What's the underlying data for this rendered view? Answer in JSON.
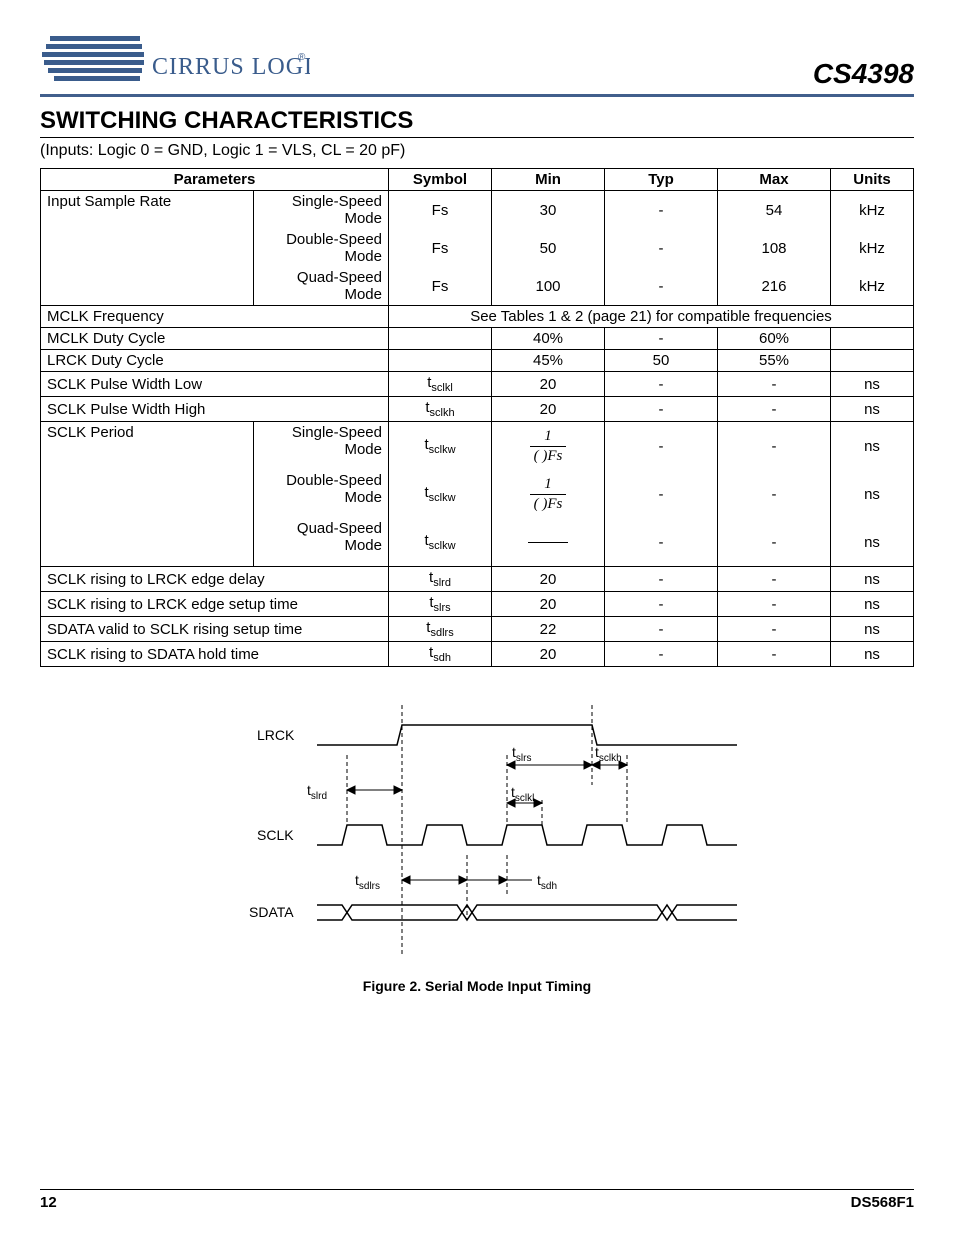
{
  "logo_text": "CIRRUS LOGIC",
  "logo_mark": "®",
  "part_number": "CS4398",
  "section_title": "SWITCHING CHARACTERISTICS",
  "conditions": "(Inputs: Logic 0 = GND, Logic 1 = VLS, CL = 20 pF)",
  "headers": {
    "parameters": "Parameters",
    "symbol": "Symbol",
    "min": "Min",
    "typ": "Typ",
    "max": "Max",
    "units": "Units"
  },
  "rows": {
    "isr": {
      "label": "Input Sample Rate",
      "modes": {
        "single": {
          "label": "Single-Speed Mode",
          "symbol": "Fs",
          "min": "30",
          "typ": "-",
          "max": "54",
          "units": "kHz"
        },
        "double": {
          "label": "Double-Speed Mode",
          "symbol": "Fs",
          "min": "50",
          "typ": "-",
          "max": "108",
          "units": "kHz"
        },
        "quad": {
          "label": "Quad-Speed Mode",
          "symbol": "Fs",
          "min": "100",
          "typ": "-",
          "max": "216",
          "units": "kHz"
        }
      }
    },
    "mclk_freq": {
      "label": "MCLK Frequency",
      "note": "See Tables 1 & 2 (page 21) for compatible frequencies"
    },
    "mclk_duty": {
      "label": "MCLK Duty Cycle",
      "min": "40%",
      "typ": "-",
      "max": "60%"
    },
    "lrck_duty": {
      "label": "LRCK Duty Cycle",
      "min": "45%",
      "typ": "50",
      "max": "55%"
    },
    "sclk_pwl": {
      "label": "SCLK Pulse Width Low",
      "sym_main": "t",
      "sym_sub": "sclkl",
      "min": "20",
      "typ": "-",
      "max": "-",
      "units": "ns"
    },
    "sclk_pwh": {
      "label": "SCLK Pulse Width High",
      "sym_main": "t",
      "sym_sub": "sclkh",
      "min": "20",
      "typ": "-",
      "max": "-",
      "units": "ns"
    },
    "sclk_period": {
      "label": "SCLK Period",
      "modes": {
        "single": {
          "label": "Single-Speed Mode",
          "sym_main": "t",
          "sym_sub": "sclkw",
          "frac_num": "1",
          "frac_den": "(   )Fs",
          "typ": "-",
          "max": "-",
          "units": "ns"
        },
        "double": {
          "label": "Double-Speed Mode",
          "sym_main": "t",
          "sym_sub": "sclkw",
          "frac_num": "1",
          "frac_den": "(   )Fs",
          "typ": "-",
          "max": "-",
          "units": "ns"
        },
        "quad": {
          "label": "Quad-Speed Mode",
          "sym_main": "t",
          "sym_sub": "sclkw",
          "typ": "-",
          "max": "-",
          "units": "ns"
        }
      }
    },
    "slrd": {
      "label": "SCLK rising to LRCK edge delay",
      "sym_main": "t",
      "sym_sub": "slrd",
      "min": "20",
      "typ": "-",
      "max": "-",
      "units": "ns"
    },
    "slrs": {
      "label": "SCLK rising to LRCK edge setup time",
      "sym_main": "t",
      "sym_sub": "slrs",
      "min": "20",
      "typ": "-",
      "max": "-",
      "units": "ns"
    },
    "sdlrs": {
      "label": "SDATA valid to SCLK rising setup time",
      "sym_main": "t",
      "sym_sub": "sdlrs",
      "min": "22",
      "typ": "-",
      "max": "-",
      "units": "ns"
    },
    "sdh": {
      "label": "SCLK rising to SDATA hold time",
      "sym_main": "t",
      "sym_sub": "sdh",
      "min": "20",
      "typ": "-",
      "max": "-",
      "units": "ns"
    }
  },
  "timing": {
    "lrck": "LRCK",
    "sclk": "SCLK",
    "sdata": "SDATA",
    "t_slrd": "slrd",
    "t_slrs": "slrs",
    "t_sclkh": "sclkh",
    "t_sclkl": "sclkl",
    "t_sdlrs": "sdlrs",
    "t_sdh": "sdh",
    "t_prefix": "t"
  },
  "figure_caption": "Figure 2.  Serial Mode Input Timing",
  "footer": {
    "page": "12",
    "doc": "DS568F1"
  }
}
